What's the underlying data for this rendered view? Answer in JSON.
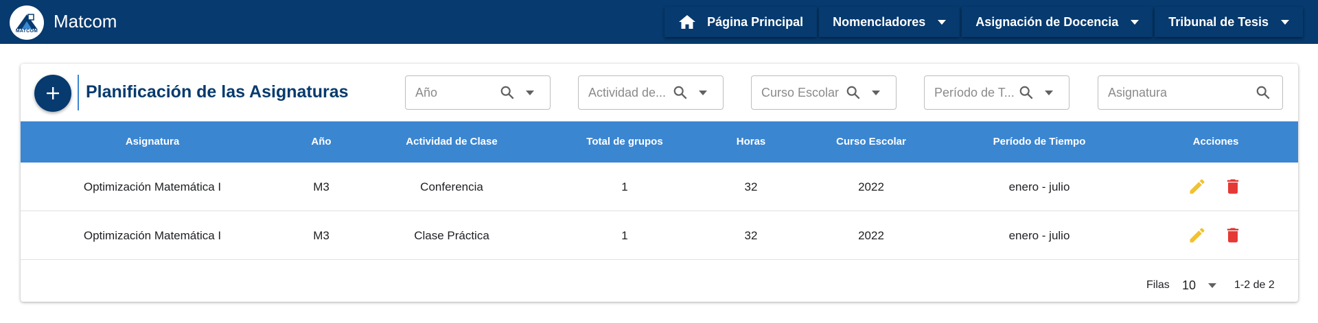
{
  "app": {
    "title": "Matcom",
    "logo_text": "MATCOM"
  },
  "nav": [
    {
      "label": "Página Principal",
      "icon": "home-icon"
    },
    {
      "label": "Nomencladores",
      "icon": "caret-down-icon"
    },
    {
      "label": "Asignación de Docencia",
      "icon": "caret-down-icon"
    },
    {
      "label": "Tribunal de Tesis",
      "icon": "caret-down-icon"
    }
  ],
  "page": {
    "title": "Planificación de las Asignaturas",
    "add_icon": "plus-icon"
  },
  "filters": [
    {
      "placeholder": "Año"
    },
    {
      "placeholder": "Actividad de..."
    },
    {
      "placeholder": "Curso Escolar"
    },
    {
      "placeholder": "Período de T..."
    },
    {
      "placeholder": "Asignatura"
    }
  ],
  "table": {
    "headers": [
      "Asignatura",
      "Año",
      "Actividad de Clase",
      "Total de grupos",
      "Horas",
      "Curso Escolar",
      "Período de Tiempo",
      "Acciones"
    ],
    "rows": [
      {
        "asignatura": "Optimización Matemática I",
        "anio": "M3",
        "actividad": "Conferencia",
        "grupos": "1",
        "horas": "32",
        "curso": "2022",
        "periodo": "enero - julio"
      },
      {
        "asignatura": "Optimización Matemática I",
        "anio": "M3",
        "actividad": "Clase Práctica",
        "grupos": "1",
        "horas": "32",
        "curso": "2022",
        "periodo": "enero - julio"
      }
    ]
  },
  "pagination": {
    "rows_label": "Filas",
    "rows_per_page": "10",
    "range": "1-2 de 2"
  },
  "colors": {
    "primary": "#073a6e",
    "header": "#3b86d1",
    "edit": "#f2c12e",
    "delete": "#e53935"
  }
}
